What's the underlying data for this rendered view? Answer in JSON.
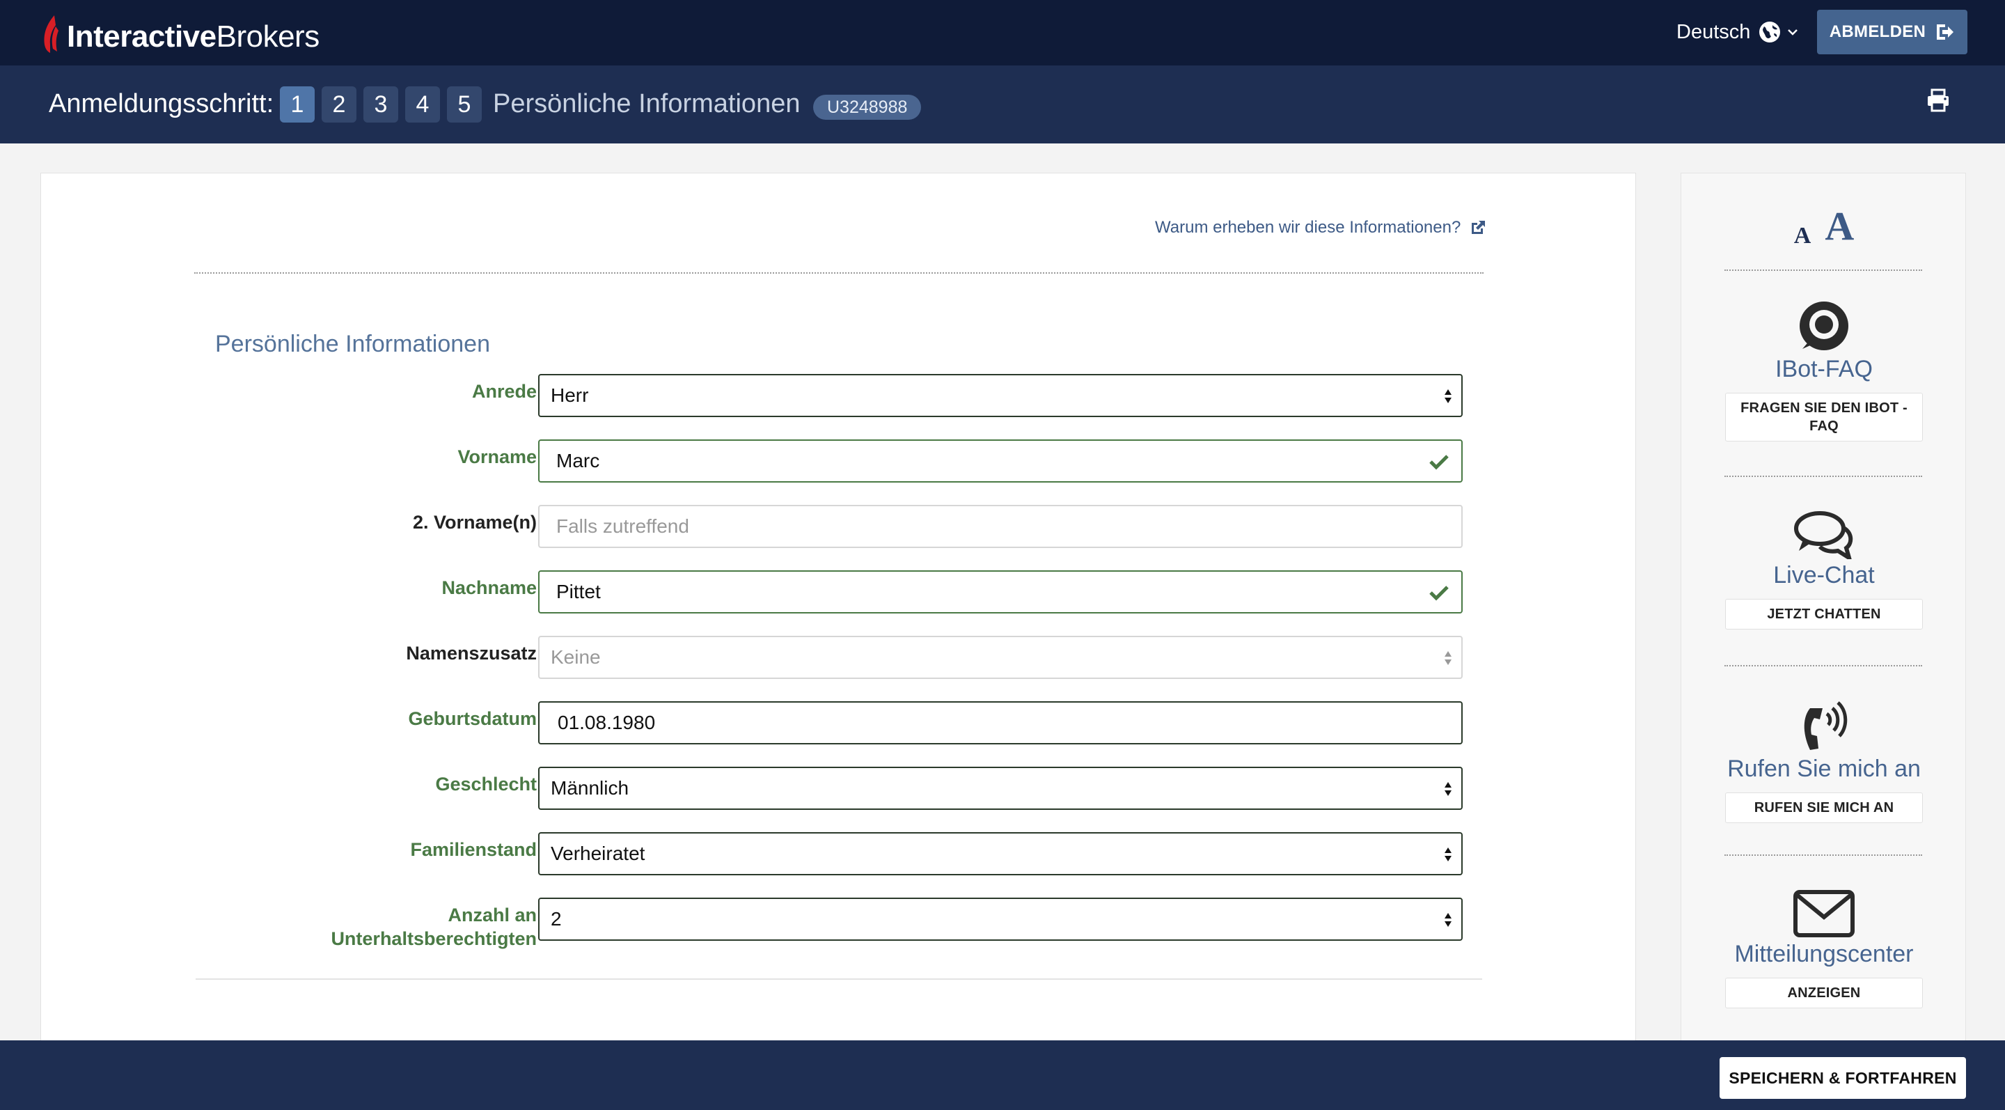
{
  "header": {
    "logo_bold": "Interactive",
    "logo_light": "Brokers",
    "language": "Deutsch",
    "logout_label": "ABMELDEN"
  },
  "stepbar": {
    "label": "Anmeldungsschritt:",
    "steps": [
      "1",
      "2",
      "3",
      "4",
      "5"
    ],
    "active_step": "1",
    "title": "Persönliche Informationen",
    "account_id": "U3248988"
  },
  "main": {
    "why_link": "Warum erheben wir diese Informationen?",
    "section_title": "Persönliche Informationen",
    "fields": {
      "anrede": {
        "label": "Anrede",
        "value": "Herr"
      },
      "vorname": {
        "label": "Vorname",
        "value": "Marc"
      },
      "vorname2": {
        "label": "2. Vorname(n)",
        "placeholder": "Falls zutreffend"
      },
      "nachname": {
        "label": "Nachname",
        "value": "Pittet"
      },
      "namenszusatz": {
        "label": "Namenszusatz",
        "value": "Keine"
      },
      "geburtsdatum": {
        "label": "Geburtsdatum",
        "value": "01.08.1980"
      },
      "geschlecht": {
        "label": "Geschlecht",
        "value": "Männlich"
      },
      "familienstand": {
        "label": "Familienstand",
        "value": "Verheiratet"
      },
      "unterhalt": {
        "label_line1": "Anzahl an",
        "label_line2": "Unterhaltsberechtigten",
        "value": "2"
      }
    }
  },
  "sidebar": {
    "font_small": "A",
    "font_large": "A",
    "ibot": {
      "title": "IBot-FAQ",
      "button": "FRAGEN SIE DEN IBOT - FAQ",
      "icon": "ibot-icon"
    },
    "chat": {
      "title": "Live-Chat",
      "button": "JETZT CHATTEN",
      "icon": "chat-bubbles-icon"
    },
    "call": {
      "title": "Rufen Sie mich an",
      "button": "RUFEN SIE MICH AN",
      "icon": "phone-ringing-icon"
    },
    "messages": {
      "title": "Mitteilungscenter",
      "button": "ANZEIGEN",
      "icon": "envelope-icon"
    }
  },
  "footer": {
    "save_label": "SPEICHERN & FORTFAHREN"
  },
  "colors": {
    "topbar": "#0f1b38",
    "stepbar": "#1e2e52",
    "accent_blue": "#44648f",
    "valid_green": "#4a7a45"
  }
}
